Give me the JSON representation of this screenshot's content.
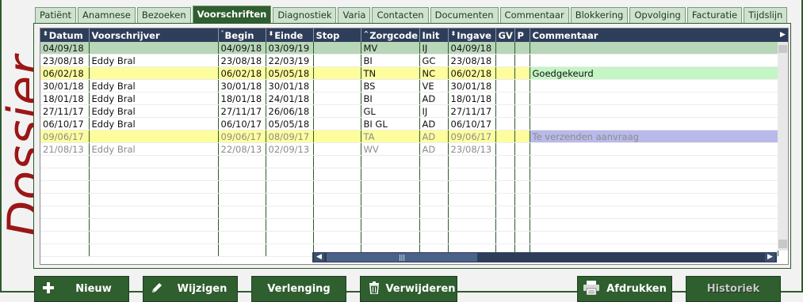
{
  "side_label": "Dossier",
  "tabs": [
    {
      "label": "Patiënt"
    },
    {
      "label": "Anamnese"
    },
    {
      "label": "Bezoeken"
    },
    {
      "label": "Voorschriften",
      "active": true
    },
    {
      "label": "Diagnostiek"
    },
    {
      "label": "Varia"
    },
    {
      "label": "Contacten"
    },
    {
      "label": "Documenten"
    },
    {
      "label": "Commentaar"
    },
    {
      "label": "Blokkering"
    },
    {
      "label": "Opvolging"
    },
    {
      "label": "Facturatie"
    },
    {
      "label": "Tijdslijn"
    }
  ],
  "columns": [
    {
      "label": "Datum",
      "sort": "both"
    },
    {
      "label": "Voorschrijver",
      "sort": ""
    },
    {
      "label": "Begin",
      "sort": "down"
    },
    {
      "label": "Einde",
      "sort": "both"
    },
    {
      "label": "Stop",
      "sort": ""
    },
    {
      "label": "Zorgcode",
      "sort": "up"
    },
    {
      "label": "Init",
      "sort": ""
    },
    {
      "label": "Ingave",
      "sort": "both"
    },
    {
      "label": "GV",
      "sort": ""
    },
    {
      "label": "P",
      "sort": ""
    },
    {
      "label": "Commentaar",
      "sort": ""
    }
  ],
  "rows": [
    {
      "cells": [
        "04/09/18",
        "",
        "04/09/18",
        "03/09/19",
        "",
        "MV",
        "IJ",
        "04/09/18",
        "",
        "",
        ""
      ],
      "style": "sel"
    },
    {
      "cells": [
        "23/08/18",
        "Eddy Bral",
        "23/08/18",
        "22/03/19",
        "",
        "BI",
        "GC",
        "23/08/18",
        "",
        "",
        ""
      ],
      "style": ""
    },
    {
      "cells": [
        "06/02/18",
        "",
        "06/02/18",
        "05/05/18",
        "",
        "TN",
        "NC",
        "06/02/18",
        "",
        "",
        "Goedgekeurd"
      ],
      "style": "yel",
      "comment_style": "green"
    },
    {
      "cells": [
        "30/01/18",
        "Eddy Bral",
        "30/01/18",
        "30/01/18",
        "",
        "BS",
        "VE",
        "30/01/18",
        "",
        "",
        ""
      ],
      "style": ""
    },
    {
      "cells": [
        "18/01/18",
        "Eddy Bral",
        "18/01/18",
        "24/01/18",
        "",
        "BI",
        "AD",
        "18/01/18",
        "",
        "",
        ""
      ],
      "style": ""
    },
    {
      "cells": [
        "27/11/17",
        "Eddy Bral",
        "27/11/17",
        "26/06/18",
        "",
        "GL",
        "IJ",
        "27/11/17",
        "",
        "",
        ""
      ],
      "style": ""
    },
    {
      "cells": [
        "06/10/17",
        "Eddy Bral",
        "06/10/17",
        "05/05/18",
        "",
        "BI GL",
        "AD",
        "06/10/17",
        "",
        "",
        ""
      ],
      "style": ""
    },
    {
      "cells": [
        "09/06/17",
        "",
        "09/06/17",
        "08/09/17",
        "",
        "TA",
        "AD",
        "09/06/17",
        "",
        "",
        "Te verzenden aanvraag"
      ],
      "style": "yel grey",
      "comment_style": "purple"
    },
    {
      "cells": [
        "21/08/13",
        "Eddy Bral",
        "22/08/13",
        "02/09/13",
        "",
        "WV",
        "AD",
        "23/08/13",
        "",
        "",
        ""
      ],
      "style": "grey"
    }
  ],
  "empty_rows": 8,
  "buttons": {
    "new": "Nieuw",
    "edit": "Wijzigen",
    "extend": "Verlenging",
    "delete": "Verwijderen",
    "print": "Afdrukken",
    "history": "Historiek"
  },
  "colors": {
    "accent_green": "#2f5e2f",
    "header_navy": "#2e3e5a",
    "dossier_red": "#9b1616",
    "highlight_yellow": "#fdfd9e",
    "comment_green": "#c4f5c4",
    "comment_purple": "#b9b9ea"
  }
}
